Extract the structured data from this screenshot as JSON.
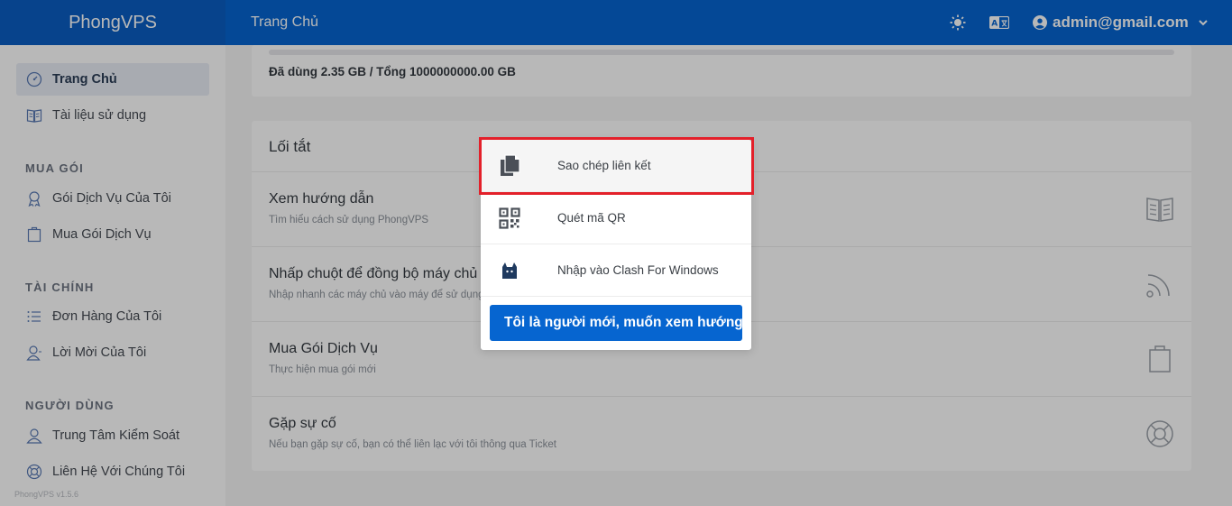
{
  "header": {
    "brand": "PhongVPS",
    "breadcrumb": "Trang Chủ",
    "theme_icon": "sun-icon",
    "language_icon": "translate-icon",
    "user_email": "admin@gmail.com"
  },
  "sidebar": {
    "items_top": [
      {
        "label": "Trang Chủ",
        "icon": "dashboard-icon",
        "active": true
      },
      {
        "label": "Tài liệu sử dụng",
        "icon": "book-icon"
      }
    ],
    "sections": [
      {
        "title": "MUA GÓI",
        "items": [
          {
            "label": "Gói Dịch Vụ Của Tôi",
            "icon": "award-icon"
          },
          {
            "label": "Mua Gói Dịch Vụ",
            "icon": "shopping-bag-icon"
          }
        ]
      },
      {
        "title": "TÀI CHÍNH",
        "items": [
          {
            "label": "Đơn Hàng Của Tôi",
            "icon": "list-icon"
          },
          {
            "label": "Lời Mời Của Tôi",
            "icon": "user-invite-icon"
          }
        ]
      },
      {
        "title": "NGƯỜI DÙNG",
        "items": [
          {
            "label": "Trung Tâm Kiểm Soát",
            "icon": "user-icon"
          },
          {
            "label": "Liên Hệ Với Chúng Tôi",
            "icon": "support-icon"
          }
        ]
      }
    ],
    "version": "PhongVPS v1.5.6"
  },
  "usage": {
    "text": "Đã dùng 2.35 GB / Tổng 1000000000.00 GB"
  },
  "shortcuts": {
    "title": "Lối tắt",
    "rows": [
      {
        "title": "Xem hướng dẫn",
        "desc": "Tìm hiểu cách sử dụng PhongVPS",
        "icon": "book-open-icon"
      },
      {
        "title": "Nhấp chuột để đồng bộ máy chủ",
        "desc": "Nhập nhanh các máy chủ vào máy để sử dụng",
        "icon": "rss-icon"
      },
      {
        "title": "Mua Gói Dịch Vụ",
        "desc": "Thực hiện mua gói mới",
        "icon": "shopping-bag-icon"
      },
      {
        "title": "Gặp sự cố",
        "desc": "Nếu bạn gặp sự cố, bạn có thể liên lạc với tôi thông qua Ticket",
        "icon": "lifebuoy-icon"
      }
    ]
  },
  "popup": {
    "items": [
      {
        "label": "Sao chép liên kết",
        "icon": "copy-icon"
      },
      {
        "label": "Quét mã QR",
        "icon": "qr-code-icon"
      },
      {
        "label": "Nhập vào Clash For Windows",
        "icon": "clash-cat-icon"
      }
    ],
    "guide_button": "Tôi là người mới, muốn xem hướng dẫn"
  },
  "colors": {
    "primary": "#0665d0",
    "highlight": "#e3202a"
  }
}
